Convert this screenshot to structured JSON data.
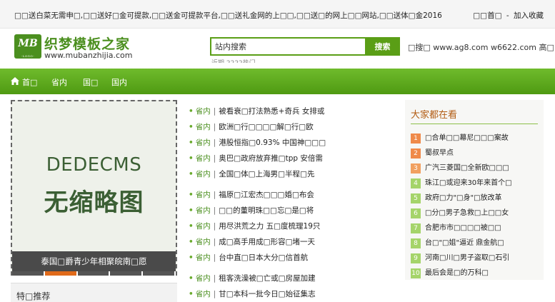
{
  "topbar": {
    "marquee": "□□送白菜无需申□,□□送好□金可提款,□□送金可提款平台,□□送礼金网的上□□,□□送□的网上□□网站,□□送体□金2016",
    "home_link": "□□首□",
    "favorite_link": "加入收藏",
    "separator": "-"
  },
  "logo": {
    "mark_text": "MB",
    "mark_sub": "-LOGO-",
    "name": "织梦模板之家",
    "url": "www.mubanzhijia.com"
  },
  "search": {
    "placeholder": "站内搜索",
    "button_label": "搜索",
    "hint": "近期 2222热门"
  },
  "header_ad": "□搜□ www.ag8.com w6622.com 高□",
  "nav": {
    "items": [
      "首□",
      "省内",
      "国□",
      "国内"
    ]
  },
  "focus": {
    "placeholder_line1": "DEDECMS",
    "placeholder_line2": "无缩略图",
    "caption": "泰国□爵青少年相聚皖南□愿",
    "dot_count": 5,
    "active_dot": 1
  },
  "special": {
    "title": "特□推荐"
  },
  "news": {
    "bullet": "•",
    "separator": "|",
    "groups": [
      [
        {
          "cat": "省内",
          "title": "被看衰□打法熟悉+奇兵 女排或"
        },
        {
          "cat": "省内",
          "title": "欧洲□行□□□□解□行□欧"
        },
        {
          "cat": "省内",
          "title": "港股恒指□0.93% 中国神□□□"
        },
        {
          "cat": "省内",
          "title": "奥巴□政府放弃推□tpp 安倍需"
        },
        {
          "cat": "省内",
          "title": "全国□体□上海男□半程□先"
        }
      ],
      [
        {
          "cat": "省内",
          "title": "福原□江宏杰□□□婚□布会"
        },
        {
          "cat": "省内",
          "title": "□□的董明珠□□忘□是□将"
        },
        {
          "cat": "省内",
          "title": "用尽洪荒之力 五□度梳理19只"
        },
        {
          "cat": "省内",
          "title": "成□高手用成□形容□堵一天"
        },
        {
          "cat": "省内",
          "title": "台中直□日本大分□信首航"
        }
      ],
      [
        {
          "cat": "省内",
          "title": "租客洗澡被□亡或□房屋加建"
        },
        {
          "cat": "省内",
          "title": "甘□本科一批今日□始征集志"
        }
      ]
    ]
  },
  "sidebar": {
    "title": "大家都在看",
    "items": [
      {
        "rank": "1",
        "text": "□合单□□幕尼□□□案故"
      },
      {
        "rank": "2",
        "text": "蜀叔早点"
      },
      {
        "rank": "3",
        "text": "广汽三菱国□全新欧□□□"
      },
      {
        "rank": "4",
        "text": "珠江□或迎来30年来首个□"
      },
      {
        "rank": "5",
        "text": "政府□力\"□身\"□放改革"
      },
      {
        "rank": "6",
        "text": "□分□男子急救□上□□女"
      },
      {
        "rank": "7",
        "text": "合肥市市□□□□被□□"
      },
      {
        "rank": "8",
        "text": "台□\"□姐\"逼近 鼎金航□"
      },
      {
        "rank": "9",
        "text": "河南□川□男子盗取□石引"
      },
      {
        "rank": "10",
        "text": "最后会是□的万科□"
      }
    ]
  },
  "colors": {
    "brand_green": "#5a9e16",
    "nav_green": "#6fbb2c",
    "rank_orange": "#ef8a4a",
    "rank_green": "#a5d46a",
    "sidebar_title": "#b25c13"
  }
}
